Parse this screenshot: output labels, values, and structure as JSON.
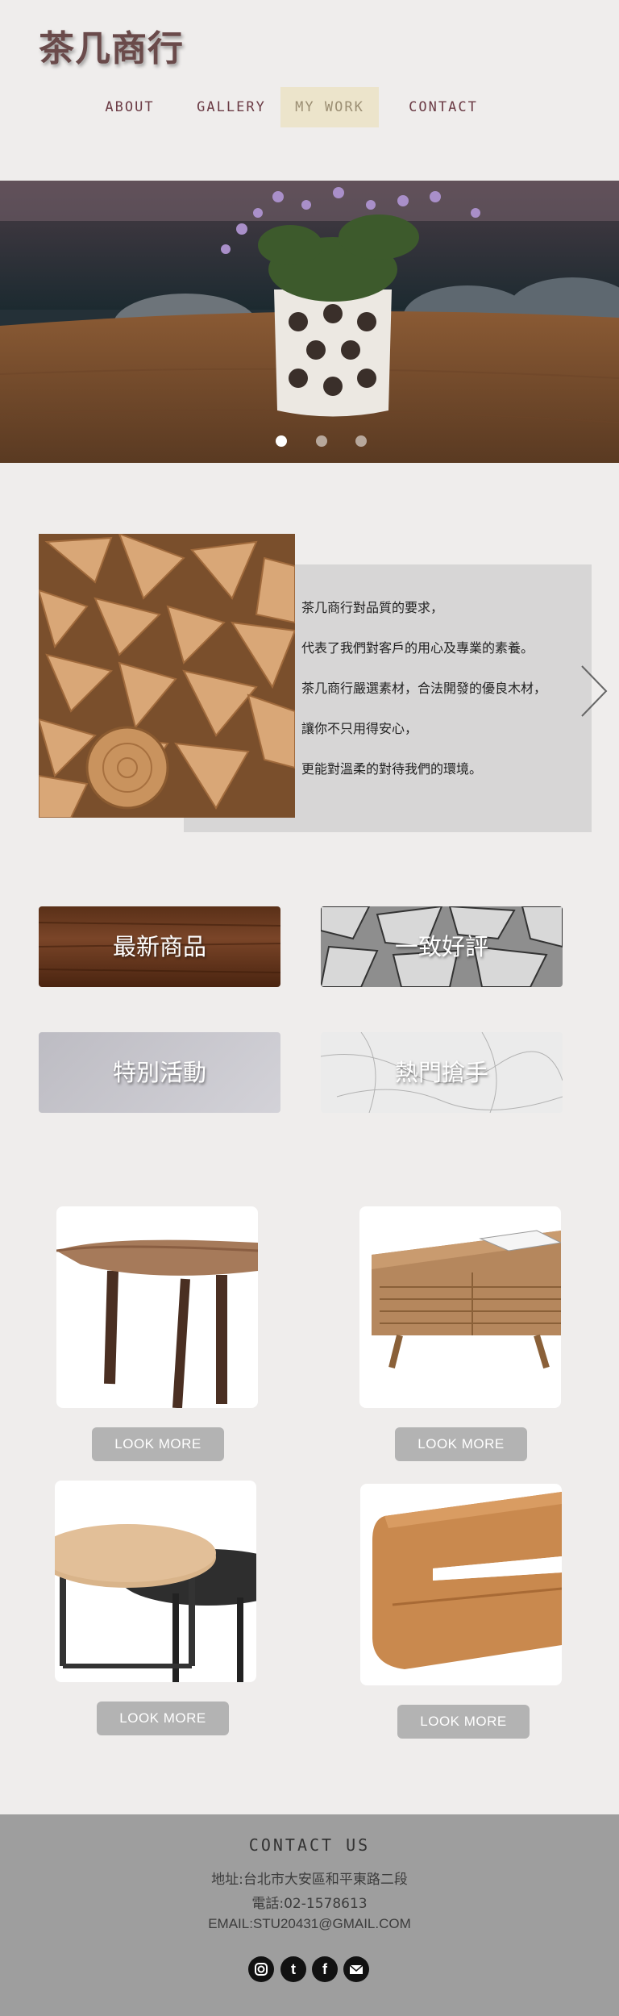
{
  "brand": {
    "logo": "茶几商行"
  },
  "nav": {
    "items": [
      {
        "label": "ABOUT"
      },
      {
        "label": "GALLERY"
      },
      {
        "label": "MY WORK",
        "active": true
      },
      {
        "label": "CONTACT"
      }
    ]
  },
  "hero": {
    "slide_count": 3,
    "active_slide": 1
  },
  "intro": {
    "lines": [
      "茶几商行對品質的要求，",
      "代表了我們對客戶的用心及專業的素養。",
      "茶几商行嚴選素材，合法開發的優良木材，",
      "讓你不只用得安心，",
      "更能對溫柔的對待我們的環境。"
    ],
    "next_icon": "chevron-right-icon"
  },
  "categories": [
    {
      "label": "最新商品"
    },
    {
      "label": "一致好評"
    },
    {
      "label": "特別活動"
    },
    {
      "label": "熱門搶手"
    }
  ],
  "products": {
    "button_label": "LOOK MORE"
  },
  "footer": {
    "title": "CONTACT US",
    "address": "地址:台北市大安區和平東路二段",
    "phone": "電話:02-1578613",
    "email": "EMAIL:STU20431@GMAIL.COM",
    "social_icons": [
      "instagram-icon",
      "tumblr-icon",
      "facebook-icon",
      "mail-icon"
    ]
  },
  "colors": {
    "logo": "#6a4a4a",
    "nav_text": "#6b3b45",
    "nav_active_bg": "#ece4cb",
    "footer_bg": "#9e9e9e",
    "button_bg": "#b3b3b3"
  }
}
